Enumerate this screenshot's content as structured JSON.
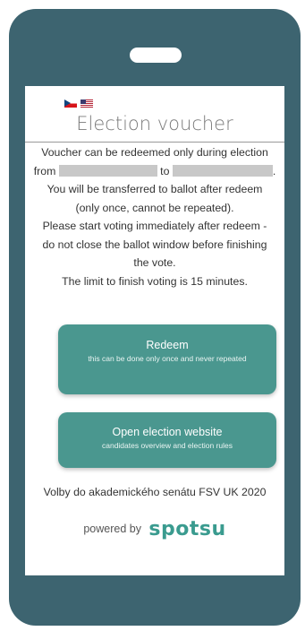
{
  "header": {
    "languages": [
      {
        "code": "cs",
        "icon": "czech-flag-icon"
      },
      {
        "code": "en",
        "icon": "us-flag-icon"
      }
    ],
    "title": "Election voucher"
  },
  "info": {
    "line1": "Voucher can be redeemed only during election",
    "from_label": "from",
    "to_label": "to",
    "period_end": ".",
    "line3": "You will be transferred to ballot after redeem",
    "line4": "(only once, cannot be repeated).",
    "line5": "Please start voting immediately after redeem -",
    "line6": "do not close the ballot window before finishing",
    "line7": "the vote.",
    "line8": "The limit to finish voting is 15 minutes."
  },
  "buttons": {
    "redeem": {
      "label": "Redeem",
      "sublabel": "this can be done only once and never repeated"
    },
    "website": {
      "label": "Open election website",
      "sublabel": "candidates overview and election rules"
    }
  },
  "footer": {
    "election_name": "Volby do akademického senátu FSV UK 2020",
    "powered_by": "powered by",
    "brand": "spotsu"
  },
  "colors": {
    "device_frame": "#3d6470",
    "button": "#4a978f",
    "brand": "#3a9b8f"
  }
}
